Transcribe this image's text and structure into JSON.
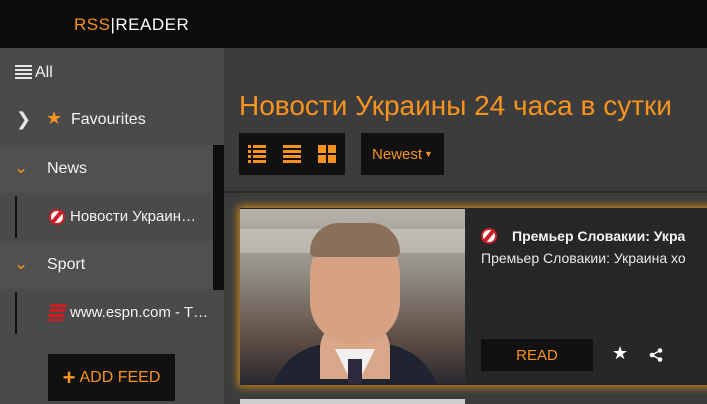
{
  "header": {
    "brand_rss": "RSS",
    "brand_sep": "|",
    "brand_reader": "READER"
  },
  "sidebar": {
    "all_label": "All",
    "favourites_label": "Favourites",
    "groups": [
      {
        "label": "News",
        "feeds": [
          {
            "label": "Новости Украин…",
            "icon": "ukraine-news-favicon"
          }
        ]
      },
      {
        "label": "Sport",
        "feeds": [
          {
            "label": "www.espn.com - T…",
            "icon": "espn-favicon"
          }
        ]
      }
    ],
    "add_feed_label": "ADD FEED"
  },
  "main": {
    "title": "Новости Украины 24 часа в сутки",
    "sort_label": "Newest",
    "view_modes": [
      "list-view-icon",
      "compact-list-icon",
      "grid-view-icon"
    ]
  },
  "article": {
    "title": "Премьер Словакии: Укра",
    "snippet": "Премьер Словакии: Украина хо",
    "read_label": "READ"
  },
  "colors": {
    "accent": "#f7931e",
    "topbar": "#0b0b0b",
    "sidebar": "#4a4a4a",
    "main": "#3c3c3c",
    "card": "#272727"
  }
}
